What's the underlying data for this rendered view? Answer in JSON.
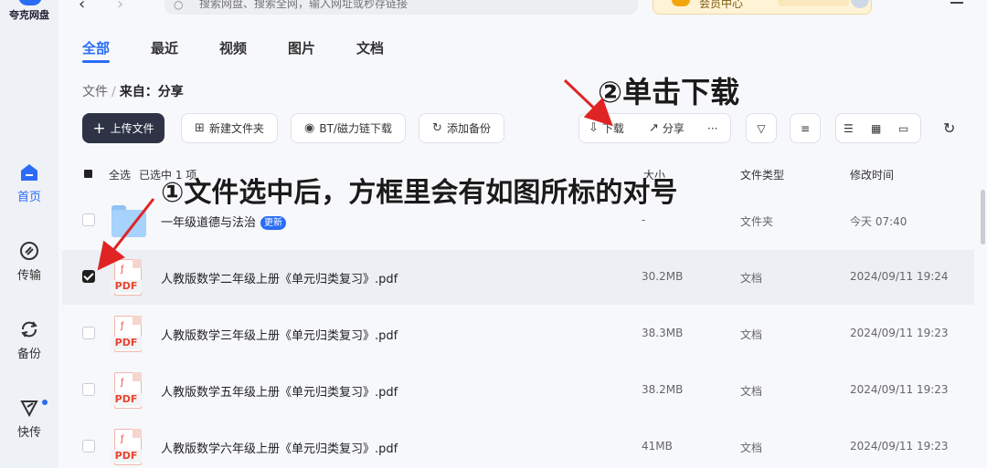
{
  "brand": {
    "name": "夸克网盘"
  },
  "sidebar": {
    "items": [
      {
        "key": "home",
        "label": "首页",
        "active": true
      },
      {
        "key": "transfer",
        "label": "传输",
        "active": false
      },
      {
        "key": "backup",
        "label": "备份",
        "active": false
      },
      {
        "key": "quick",
        "label": "快传",
        "active": false,
        "has_dot": true
      }
    ]
  },
  "search": {
    "placeholder": "搜索网盘、搜索全网，输入网址或秒存链接"
  },
  "cloud_pill": {
    "label": "会员中心"
  },
  "tabs": [
    {
      "label": "全部",
      "active": true
    },
    {
      "label": "最近",
      "active": false
    },
    {
      "label": "视频",
      "active": false
    },
    {
      "label": "图片",
      "active": false
    },
    {
      "label": "文档",
      "active": false
    }
  ],
  "breadcrumb": {
    "root": "文件",
    "separator": "/",
    "current": "来自：分享"
  },
  "toolbar": {
    "upload": "上传文件",
    "new_folder": "新建文件夹",
    "bt_download": "BT/磁力链下载",
    "add_backup": "添加备份",
    "download": "下载",
    "share": "分享",
    "more": "···"
  },
  "table": {
    "select_all": "全选",
    "selected_text": "已选中 1 项",
    "col_size": "大小",
    "col_type": "文件类型",
    "col_modified": "修改时间",
    "rows": [
      {
        "name": "一年级道德与法治",
        "badge": "更新",
        "size": "-",
        "type": "文件夹",
        "modified": "今天 07:40",
        "kind": "folder",
        "checked": false
      },
      {
        "name": "人教版数学二年级上册《单元归类复习》.pdf",
        "size": "30.2MB",
        "type": "文档",
        "modified": "2024/09/11 19:24",
        "kind": "pdf",
        "checked": true
      },
      {
        "name": "人教版数学三年级上册《单元归类复习》.pdf",
        "size": "38.3MB",
        "type": "文档",
        "modified": "2024/09/11 19:23",
        "kind": "pdf",
        "checked": false
      },
      {
        "name": "人教版数学五年级上册《单元归类复习》.pdf",
        "size": "38.2MB",
        "type": "文档",
        "modified": "2024/09/11 19:23",
        "kind": "pdf",
        "checked": false
      },
      {
        "name": "人教版数学六年级上册《单元归类复习》.pdf",
        "size": "41MB",
        "type": "文档",
        "modified": "2024/09/11 19:23",
        "kind": "pdf",
        "checked": false
      }
    ]
  },
  "icons": {
    "pdf_label": "PDF"
  },
  "annotations": {
    "step1": "①文件选中后，方框里会有如图所标的对号",
    "step2": "②单击下载"
  },
  "colors": {
    "accent": "#2a6cf6",
    "primary_button": "#2e3446",
    "annotation_arrow": "#e02424"
  }
}
